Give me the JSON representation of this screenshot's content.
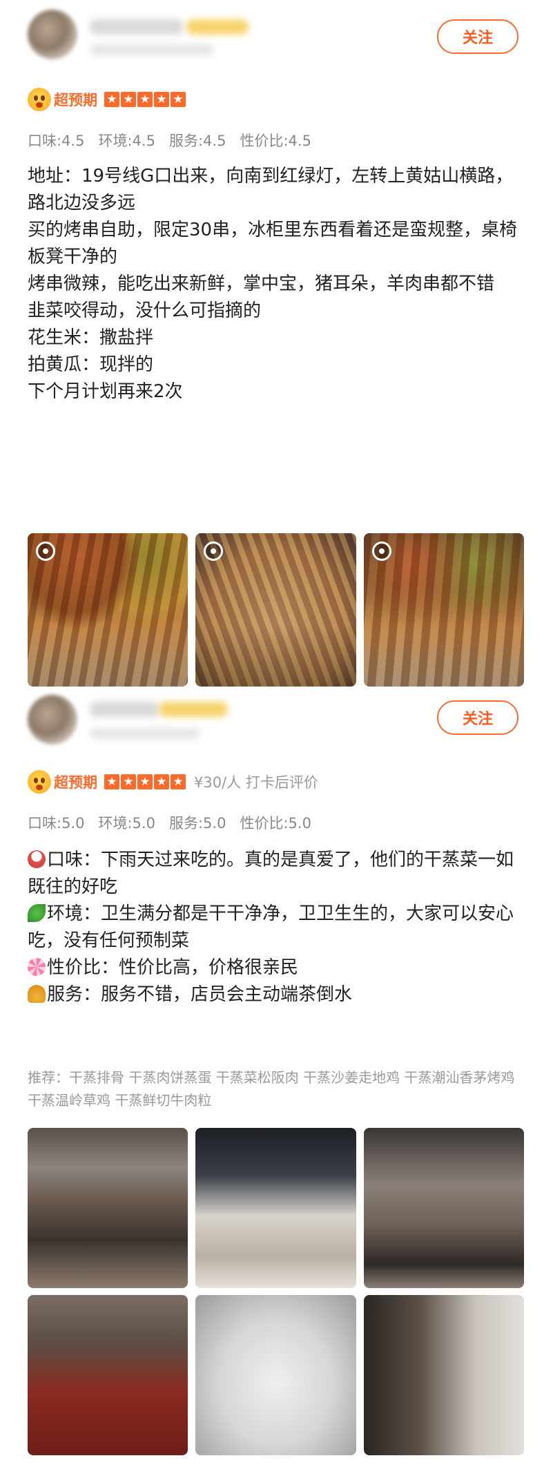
{
  "reviews": [
    {
      "follow_label": "关注",
      "tag_label": "超预期",
      "extra": "",
      "scores": {
        "taste": "口味:4.5",
        "env": "环境:4.5",
        "service": "服务:4.5",
        "value": "性价比:4.5"
      },
      "lines": [
        "地址：19号线G口出来，向南到红绿灯，左转上黄姑山横路，路北边没多远",
        "买的烤串自助，限定30串，冰柜里东西看着还是蛮规整，桌椅板凳干净的",
        "烤串微辣，能吃出来新鲜，掌中宝，猪耳朵，羊肉串都不错",
        "韭菜咬得动，没什么可指摘的",
        "花生米：撒盐拌",
        "拍黄瓜：现拌的",
        "下个月计划再来2次"
      ]
    },
    {
      "follow_label": "关注",
      "tag_label": "超预期",
      "extra": "¥30/人 打卡后评价",
      "scores": {
        "taste": "口味:5.0",
        "env": "环境:5.0",
        "service": "服务:5.0",
        "value": "性价比:5.0"
      },
      "lines": [
        "口味：下雨天过来吃的。真的是真爱了，他们的干蒸菜一如既往的好吃",
        "环境：卫生满分都是干干净净，卫卫生生的，大家可以安心吃，没有任何预制菜",
        "性价比：性价比高，价格很亲民",
        "服务：服务不错，店员会主动端茶倒水"
      ],
      "line_icons": [
        "rice-bowl-icon",
        "herb-icon",
        "lollipop-icon",
        "bell-icon"
      ],
      "recommend": "推荐：干蒸排骨 干蒸肉饼蒸蛋 干蒸菜松阪肉 干蒸沙姜走地鸡 干蒸潮汕香茅烤鸡 干蒸温岭草鸡 干蒸鲜切牛肉粒"
    }
  ],
  "colors": {
    "accent": "#ff6a2b",
    "muted": "#888888"
  }
}
